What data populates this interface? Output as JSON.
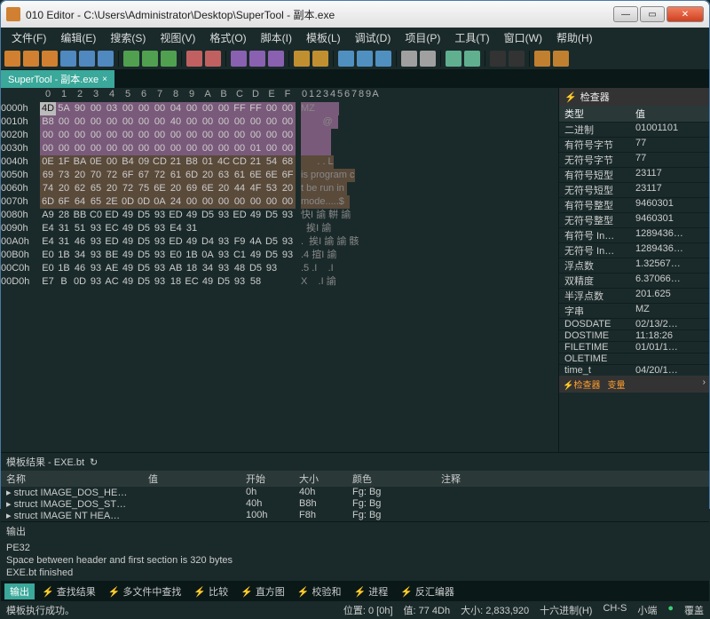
{
  "titlebar": {
    "app": "010 Editor",
    "path": "C:\\Users\\Administrator\\Desktop\\SuperTool - 副本.exe"
  },
  "menu": [
    "文件(F)",
    "编辑(E)",
    "搜索(S)",
    "视图(V)",
    "格式(O)",
    "脚本(I)",
    "模板(L)",
    "调试(D)",
    "项目(P)",
    "工具(T)",
    "窗口(W)",
    "帮助(H)"
  ],
  "tab": {
    "label": "SuperTool - 副本.exe"
  },
  "hex": {
    "header_bytes": [
      "0",
      "1",
      "2",
      "3",
      "4",
      "5",
      "6",
      "7",
      "8",
      "9",
      "A",
      "B",
      "C",
      "D",
      "E",
      "F"
    ],
    "header_ascii": [
      "0",
      "1",
      "2",
      "3",
      "4",
      "5",
      "6",
      "7",
      "8",
      "9",
      "A"
    ],
    "rows": [
      {
        "addr": "0000h",
        "b": [
          "4D",
          "5A",
          "90",
          "00",
          "03",
          "00",
          "00",
          "00",
          "04",
          "00",
          "00",
          "00",
          "FF",
          "FF",
          "00",
          "00"
        ],
        "a": "MZ         ",
        "sel": "A",
        "cursor": 0
      },
      {
        "addr": "0010h",
        "b": [
          "B8",
          "00",
          "00",
          "00",
          "00",
          "00",
          "00",
          "00",
          "40",
          "00",
          "00",
          "00",
          "00",
          "00",
          "00",
          "00"
        ],
        "a": "        @  ",
        "sel": "A"
      },
      {
        "addr": "0020h",
        "b": [
          "00",
          "00",
          "00",
          "00",
          "00",
          "00",
          "00",
          "00",
          "00",
          "00",
          "00",
          "00",
          "00",
          "00",
          "00",
          "00"
        ],
        "a": "           ",
        "sel": "A"
      },
      {
        "addr": "0030h",
        "b": [
          "00",
          "00",
          "00",
          "00",
          "00",
          "00",
          "00",
          "00",
          "00",
          "00",
          "00",
          "00",
          "00",
          "01",
          "00",
          "00"
        ],
        "a": "           ",
        "sel": "A"
      },
      {
        "addr": "0040h",
        "b": [
          "0E",
          "1F",
          "BA",
          "0E",
          "00",
          "B4",
          "09",
          "CD",
          "21",
          "B8",
          "01",
          "4C",
          "CD",
          "21",
          "54",
          "68"
        ],
        "a": "      . . L",
        "sel": "B"
      },
      {
        "addr": "0050h",
        "b": [
          "69",
          "73",
          "20",
          "70",
          "72",
          "6F",
          "67",
          "72",
          "61",
          "6D",
          "20",
          "63",
          "61",
          "6E",
          "6E",
          "6F"
        ],
        "a": "is program c",
        "sel": "B"
      },
      {
        "addr": "0060h",
        "b": [
          "74",
          "20",
          "62",
          "65",
          "20",
          "72",
          "75",
          "6E",
          "20",
          "69",
          "6E",
          "20",
          "44",
          "4F",
          "53",
          "20"
        ],
        "a": "t be run in ",
        "sel": "B"
      },
      {
        "addr": "0070h",
        "b": [
          "6D",
          "6F",
          "64",
          "65",
          "2E",
          "0D",
          "0D",
          "0A",
          "24",
          "00",
          "00",
          "00",
          "00",
          "00",
          "00",
          "00"
        ],
        "a": "mode.....$  ",
        "sel": "B"
      },
      {
        "addr": "0080h",
        "b": [
          "A9",
          "28",
          "BB",
          "C0",
          "ED",
          "49",
          "D5",
          "93",
          "ED",
          "49",
          "D5",
          "93",
          "ED",
          "49",
          "D5",
          "93"
        ],
        "a": "快I 諭 輧 諭"
      },
      {
        "addr": "0090h",
        "b": [
          "E4",
          "31",
          "51",
          "93",
          "EC",
          "49",
          "D5",
          "93",
          "E4",
          "31",
          "  ",
          "  ",
          "  ",
          "  ",
          "  ",
          "  "
        ],
        "a": "  挨I 諭"
      },
      {
        "addr": "00A0h",
        "b": [
          "E4",
          "31",
          "46",
          "93",
          "ED",
          "49",
          "D5",
          "93",
          "ED",
          "49",
          "D4",
          "93",
          "F9",
          "4A",
          "D5",
          "93"
        ],
        "a": ".  挨I 諭 諭 骸"
      },
      {
        "addr": "00B0h",
        "b": [
          "E0",
          "1B",
          "34",
          "93",
          "BE",
          "49",
          "D5",
          "93",
          "E0",
          "1B",
          "0A",
          "93",
          "C1",
          "49",
          "D5",
          "93"
        ],
        "a": ".4 揎I 諭"
      },
      {
        "addr": "00C0h",
        "b": [
          "E0",
          "1B",
          "46",
          "93",
          "AE",
          "49",
          "D5",
          "93",
          "AB",
          "18",
          "34",
          "93",
          "48",
          "D5",
          "93",
          "  "
        ],
        "a": ".5 .I    .I"
      },
      {
        "addr": "00D0h",
        "b": [
          "E7",
          "B",
          "0D",
          "93",
          "AC",
          "49",
          "D5",
          "93",
          "18",
          "EC",
          "49",
          "D5",
          "93",
          "58",
          "  ",
          "  "
        ],
        "a": "X    .I 諭"
      }
    ]
  },
  "inspector": {
    "title": "检查器",
    "head_type": "类型",
    "head_value": "值",
    "rows": [
      {
        "t": "二进制",
        "v": "01001101"
      },
      {
        "t": "有符号字节",
        "v": "77"
      },
      {
        "t": "无符号字节",
        "v": "77"
      },
      {
        "t": "有符号短型",
        "v": "23117"
      },
      {
        "t": "无符号短型",
        "v": "23117"
      },
      {
        "t": "有符号整型",
        "v": "9460301"
      },
      {
        "t": "无符号整型",
        "v": "9460301"
      },
      {
        "t": "有符号 In…",
        "v": "1289436…"
      },
      {
        "t": "无符号 In…",
        "v": "1289436…"
      },
      {
        "t": "浮点数",
        "v": "1.32567…"
      },
      {
        "t": "双精度",
        "v": "6.37066…"
      },
      {
        "t": "半浮点数",
        "v": "201.625"
      },
      {
        "t": "字串",
        "v": "MZ"
      },
      {
        "t": "DOSDATE",
        "v": "02/13/2…"
      },
      {
        "t": "DOSTIME",
        "v": "11:18:26"
      },
      {
        "t": "FILETIME",
        "v": "01/01/1…"
      },
      {
        "t": "OLETIME",
        "v": ""
      },
      {
        "t": "time_t",
        "v": "04/20/1…"
      }
    ],
    "foot_tabs": [
      "检查器",
      "变量"
    ]
  },
  "template": {
    "title": "模板结果 - EXE.bt",
    "cols": [
      "名称",
      "值",
      "开始",
      "大小",
      "颜色",
      "注释"
    ],
    "rows": [
      {
        "name": "struct IMAGE_DOS_HE…",
        "val": "",
        "start": "0h",
        "size": "40h",
        "color": "Fg:   Bg"
      },
      {
        "name": "struct IMAGE_DOS_ST…",
        "val": "",
        "start": "40h",
        "size": "B8h",
        "color": "Fg:   Bg"
      },
      {
        "name": "struct IMAGE NT HEA…",
        "val": "",
        "start": "100h",
        "size": "F8h",
        "color": "Fg:   Bg"
      }
    ]
  },
  "output": {
    "title": "输出",
    "lines": [
      "PE32",
      "Space between header and first section is 320 bytes",
      "EXE.bt finished"
    ]
  },
  "bottomtabs": [
    "输出",
    "查找结果",
    "多文件中查找",
    "比较",
    "直方图",
    "校验和",
    "进程",
    "反汇编器"
  ],
  "status": {
    "exec": "模板执行成功。",
    "pos": "位置: 0 [0h]",
    "val": "值: 77 4Dh",
    "size": "大小: 2,833,920",
    "hex": "十六进制(H)",
    "chs": "CH-S",
    "endian": "小端",
    "ovr": "覆盖"
  }
}
